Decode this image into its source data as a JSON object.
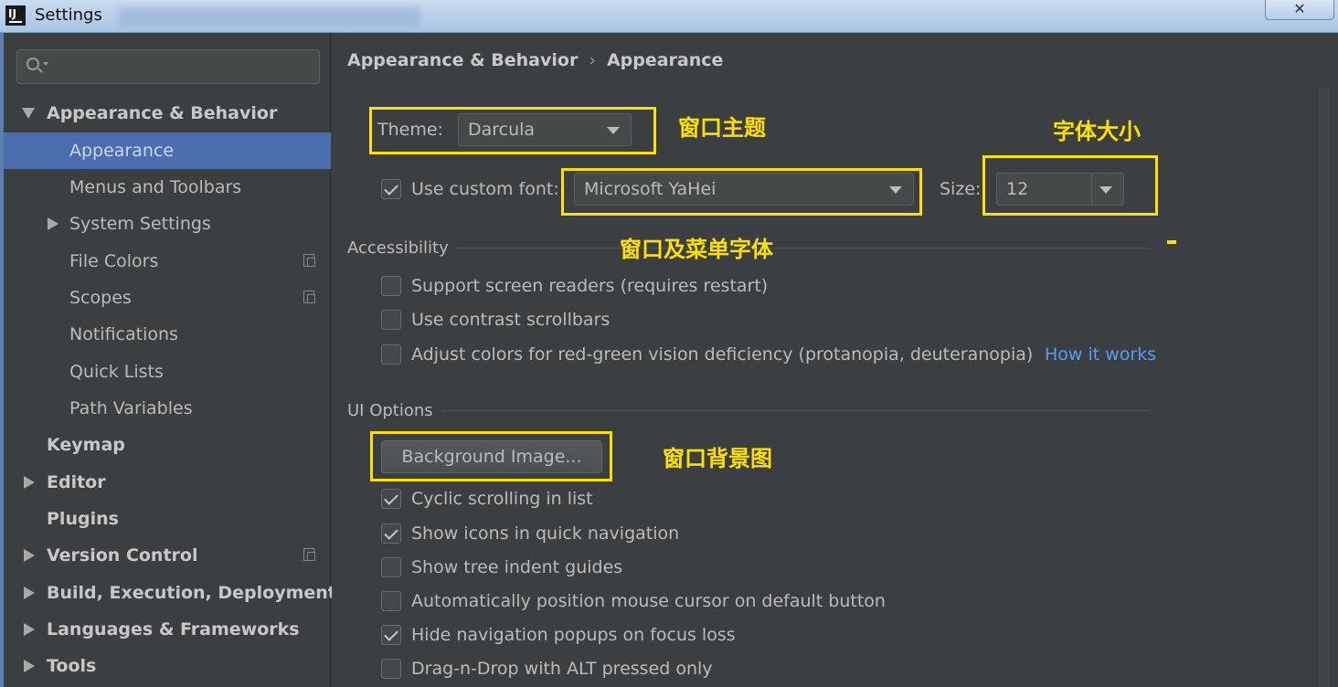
{
  "window": {
    "title": "Settings",
    "app_icon": "IJ",
    "close": "✕"
  },
  "search": {
    "placeholder": "",
    "value": ""
  },
  "sidebar": {
    "items": [
      {
        "label": "Appearance & Behavior"
      },
      {
        "label": "Appearance"
      },
      {
        "label": "Menus and Toolbars"
      },
      {
        "label": "System Settings"
      },
      {
        "label": "File Colors"
      },
      {
        "label": "Scopes"
      },
      {
        "label": "Notifications"
      },
      {
        "label": "Quick Lists"
      },
      {
        "label": "Path Variables"
      },
      {
        "label": "Keymap"
      },
      {
        "label": "Editor"
      },
      {
        "label": "Plugins"
      },
      {
        "label": "Version Control"
      },
      {
        "label": "Build, Execution, Deployment"
      },
      {
        "label": "Languages & Frameworks"
      },
      {
        "label": "Tools"
      }
    ]
  },
  "breadcrumb": {
    "parent": "Appearance & Behavior",
    "separator": "›",
    "current": "Appearance"
  },
  "theme": {
    "label": "Theme:",
    "value": "Darcula"
  },
  "font": {
    "checkbox_label": "Use custom font:",
    "checked": true,
    "value": "Microsoft YaHei"
  },
  "size": {
    "label": "Size:",
    "value": "12"
  },
  "accessibility": {
    "title": "Accessibility",
    "options": [
      {
        "label": "Support screen readers (requires restart)",
        "checked": false
      },
      {
        "label": "Use contrast scrollbars",
        "checked": false
      },
      {
        "label": "Adjust colors for red-green vision deficiency (protanopia, deuteranopia)",
        "checked": false
      }
    ],
    "link": "How it works"
  },
  "ui_options": {
    "title": "UI Options",
    "background_button": "Background Image...",
    "options": [
      {
        "label": "Cyclic scrolling in list",
        "checked": true
      },
      {
        "label": "Show icons in quick navigation",
        "checked": true
      },
      {
        "label": "Show tree indent guides",
        "checked": false
      },
      {
        "label": "Automatically position mouse cursor on default button",
        "checked": false
      },
      {
        "label": "Hide navigation popups on focus loss",
        "checked": true
      },
      {
        "label": "Drag-n-Drop with ALT pressed only",
        "checked": false
      }
    ]
  },
  "annotations": {
    "theme_note": "窗口主题",
    "size_note": "字体大小",
    "font_note": "窗口及菜单字体",
    "background_note": "窗口背景图"
  },
  "colors": {
    "background": "#3c3f41",
    "selection": "#4b6eaf",
    "link": "#589df6",
    "annotation": "#ffe000"
  }
}
